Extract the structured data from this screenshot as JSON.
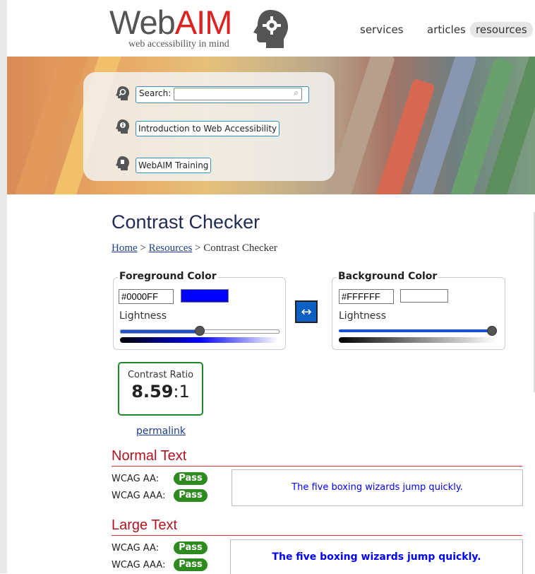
{
  "header": {
    "logo_web": "Web",
    "logo_aim": "AIM",
    "logo_tagline": "web accessibility in mind",
    "nav": [
      "services",
      "articles",
      "resources"
    ]
  },
  "searchbox": {
    "search_label": "Search:",
    "search_value": "",
    "intro_link": "Introduction to Web Accessibility",
    "training_link": "WebAIM Training"
  },
  "page": {
    "title": "Contrast Checker",
    "breadcrumb": {
      "home": "Home",
      "sep1": " > ",
      "resources": "Resources",
      "sep2": " > ",
      "current": "Contrast Checker"
    }
  },
  "foreground": {
    "legend": "Foreground Color",
    "hex": "#0000FF",
    "lightness_label": "Lightness",
    "lightness_level": 0.5
  },
  "background": {
    "legend": "Background Color",
    "hex": "#FFFFFF",
    "lightness_label": "Lightness",
    "lightness_level": 1.0
  },
  "swap_icon": "↔",
  "contrast": {
    "label": "Contrast Ratio",
    "value": "8.59",
    "suffix": ":1",
    "permalink": "permalink"
  },
  "normal_text": {
    "heading": "Normal Text",
    "aa_label": "WCAG AA:",
    "aa_result": "Pass",
    "aaa_label": "WCAG AAA:",
    "aaa_result": "Pass",
    "sample": "The five boxing wizards jump quickly."
  },
  "large_text": {
    "heading": "Large Text",
    "aa_label": "WCAG AA:",
    "aa_result": "Pass",
    "aaa_label": "WCAG AAA:",
    "aaa_result": "Pass",
    "sample": "The five boxing wizards jump quickly."
  },
  "colors": {
    "pass_green": "#2d8a1f",
    "heading_red": "#b01322",
    "fg": "#0000FF",
    "bg": "#FFFFFF",
    "accent_blue": "#0c60c4"
  }
}
